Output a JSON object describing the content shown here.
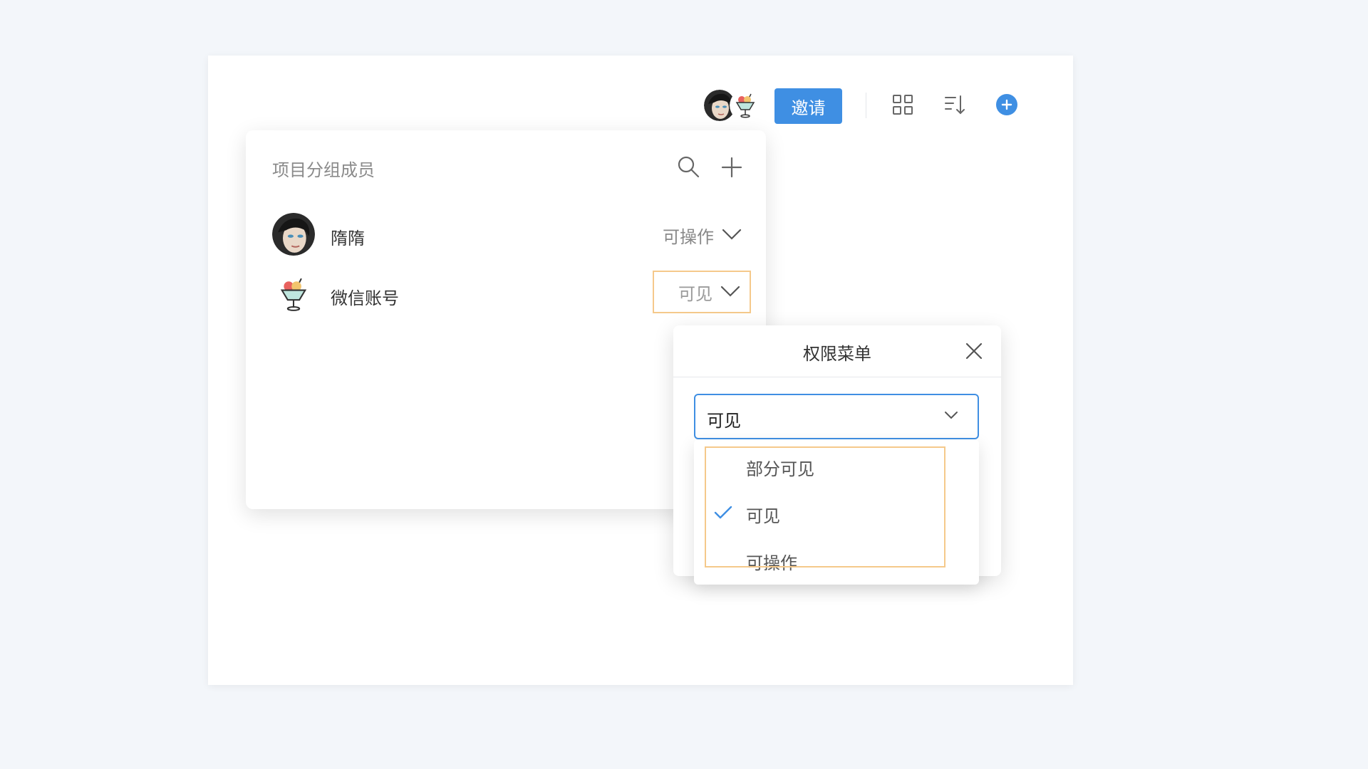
{
  "toolbar": {
    "avatars": [
      {
        "name": "person-avatar",
        "icon": "portrait-avatar"
      },
      {
        "name": "sundae-avatar",
        "icon": "ice-cream-sundae-avatar"
      }
    ],
    "invite_label": "邀请",
    "icons": [
      "grid-view-icon",
      "sort-icon",
      "add-circle-icon"
    ],
    "accent_color": "#3f8fe3"
  },
  "members_panel": {
    "title": "项目分组成员",
    "icons": [
      "search-icon",
      "plus-icon"
    ],
    "members": [
      {
        "name": "隋隋",
        "permission": "可操作",
        "avatar": "portrait-avatar"
      },
      {
        "name": "微信账号",
        "permission": "可见",
        "avatar": "ice-cream-sundae-avatar"
      }
    ]
  },
  "perm_menu": {
    "title": "权限菜单",
    "selected": "可见",
    "options": [
      {
        "label": "部分可见",
        "checked": false
      },
      {
        "label": "可见",
        "checked": true
      },
      {
        "label": "可操作",
        "checked": false
      }
    ],
    "highlight_color": "#f5c98b"
  }
}
